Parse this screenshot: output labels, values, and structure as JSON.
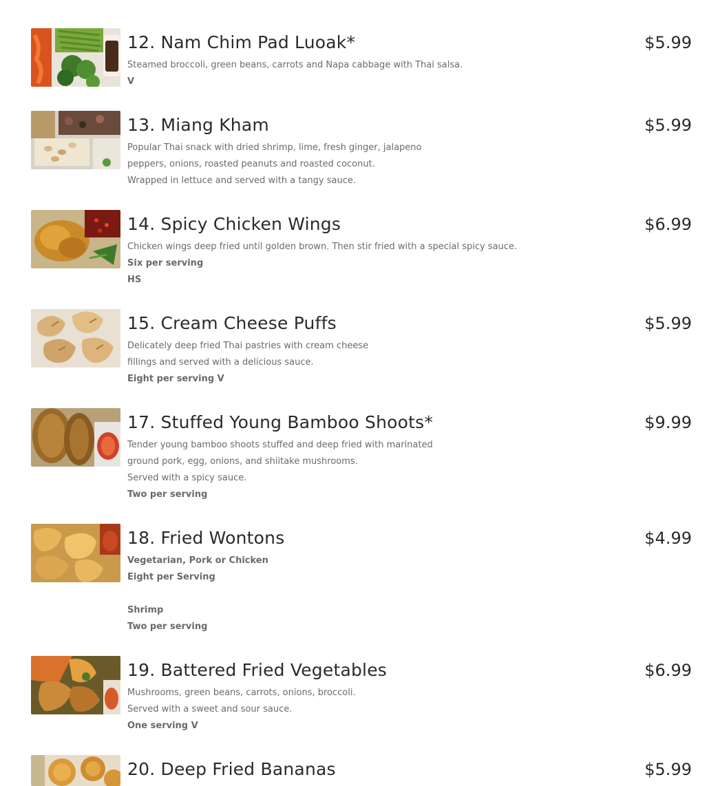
{
  "colors": {
    "title": "#2a2a2a",
    "description": "#6a6a6a",
    "background": "#ffffff"
  },
  "previous_item": {
    "tag": "V"
  },
  "items": [
    {
      "title": "12. Nam Chim Pad Luoak*",
      "price": "$5.99",
      "lines": [
        {
          "text": "Steamed broccoli, green beans, carrots and Napa cabbage with Thai salsa.",
          "strong": false
        },
        {
          "text": "V",
          "strong": true
        }
      ],
      "image_name": "steamed-vegetables-image"
    },
    {
      "title": "13. Miang Kham",
      "price": "$5.99",
      "lines": [
        {
          "text": "Popular Thai snack with dried shrimp, lime, fresh ginger, jalapeno",
          "strong": false
        },
        {
          "text": "peppers, onions, roasted peanuts and roasted coconut.",
          "strong": false
        },
        {
          "text": "Wrapped in lettuce and served with a tangy sauce.",
          "strong": false
        }
      ],
      "image_name": "miang-kham-image"
    },
    {
      "title": "14. Spicy Chicken Wings",
      "price": "$6.99",
      "lines": [
        {
          "text": "Chicken wings deep fried until golden brown. Then stir fried with a special spicy sauce.",
          "strong": false
        },
        {
          "text": "Six per serving",
          "strong": true
        },
        {
          "text": "HS",
          "strong": true
        }
      ],
      "image_name": "chicken-wings-image"
    },
    {
      "title": "15. Cream Cheese Puffs",
      "price": "$5.99",
      "lines": [
        {
          "text": "Delicately deep fried Thai pastries with cream cheese",
          "strong": false
        },
        {
          "text": "fillings and served with a delicious sauce.",
          "strong": false
        },
        {
          "text": "Eight per serving V",
          "strong": true
        }
      ],
      "image_name": "cream-cheese-puffs-image"
    },
    {
      "title": "17. Stuffed Young Bamboo Shoots*",
      "price": "$9.99",
      "lines": [
        {
          "text": "Tender young bamboo shoots stuffed and deep fried with marinated",
          "strong": false
        },
        {
          "text": "ground pork, egg, onions, and shiitake mushrooms.",
          "strong": false
        },
        {
          "text": "Served with a spicy sauce.",
          "strong": false
        },
        {
          "text": "Two per serving",
          "strong": true
        }
      ],
      "image_name": "bamboo-shoots-image"
    },
    {
      "title": "18. Fried Wontons",
      "price": "$4.99",
      "lines": [
        {
          "text": "Vegetarian, Pork or Chicken",
          "strong": true
        },
        {
          "text": "Eight per Serving",
          "strong": true
        },
        {
          "text": "",
          "strong": false
        },
        {
          "text": "Shrimp",
          "strong": true
        },
        {
          "text": "Two per serving",
          "strong": true
        }
      ],
      "image_name": "fried-wontons-image"
    },
    {
      "title": "19. Battered Fried Vegetables",
      "price": "$6.99",
      "lines": [
        {
          "text": "Mushrooms, green beans, carrots, onions, broccoli.",
          "strong": false
        },
        {
          "text": "Served with a sweet and sour sauce.",
          "strong": false
        },
        {
          "text": "One serving V",
          "strong": true
        }
      ],
      "image_name": "battered-vegetables-image"
    },
    {
      "title": "20. Deep Fried Bananas",
      "price": "$5.99",
      "lines": [],
      "image_name": "fried-bananas-image"
    }
  ]
}
